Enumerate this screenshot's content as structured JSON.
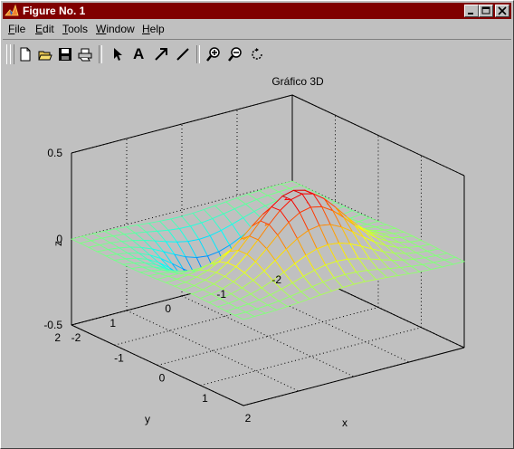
{
  "window": {
    "title": "Figure No. 1"
  },
  "menu": [
    {
      "label": "File",
      "key": "F",
      "rest": "ile"
    },
    {
      "label": "Edit",
      "key": "E",
      "rest": "dit"
    },
    {
      "label": "Tools",
      "key": "T",
      "rest": "ools"
    },
    {
      "label": "Window",
      "key": "W",
      "rest": "indow"
    },
    {
      "label": "Help",
      "key": "H",
      "rest": "elp"
    }
  ],
  "toolbar": {
    "icons": [
      "new-figure-icon",
      "open-file-icon",
      "save-icon",
      "print-icon",
      "select-arrow-icon",
      "insert-text-icon",
      "insert-arrow-icon",
      "insert-line-icon",
      "zoom-in-icon",
      "zoom-out-icon",
      "rotate-3d-icon"
    ],
    "text_tool_label": "A"
  },
  "chart_data": {
    "type": "surface-mesh",
    "title": "Gráfico 3D",
    "xlabel": "x",
    "ylabel": "y",
    "zlabel": "z",
    "xlim": [
      -2,
      2
    ],
    "ylim": [
      -2,
      2
    ],
    "zlim": [
      -0.5,
      0.5
    ],
    "xticks": [
      "-2",
      "-1",
      "0",
      "1",
      "2"
    ],
    "yticks": [
      "-2",
      "-1",
      "0",
      "1",
      "2"
    ],
    "zticks": [
      "-0.5",
      "0",
      "0.5"
    ],
    "grid": true,
    "colormap": "jet",
    "peak": {
      "x": 0.7,
      "y": 0,
      "z": 0.43
    },
    "trough": {
      "x": -0.7,
      "y": 0,
      "z": -0.43
    },
    "grid_points": 21
  }
}
